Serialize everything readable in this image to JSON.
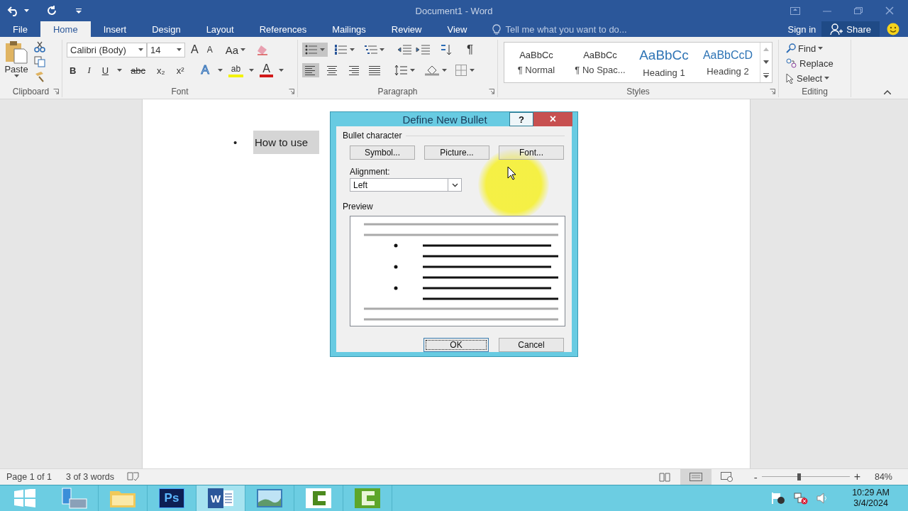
{
  "window": {
    "title": "Document1 - Word"
  },
  "tabs": [
    {
      "label": "File",
      "selected": false
    },
    {
      "label": "Home",
      "selected": true
    },
    {
      "label": "Insert",
      "selected": false
    },
    {
      "label": "Design",
      "selected": false
    },
    {
      "label": "Layout",
      "selected": false
    },
    {
      "label": "References",
      "selected": false
    },
    {
      "label": "Mailings",
      "selected": false
    },
    {
      "label": "Review",
      "selected": false
    },
    {
      "label": "View",
      "selected": false
    }
  ],
  "tell_me": {
    "placeholder": "Tell me what you want to do..."
  },
  "account": {
    "sign_in": "Sign in",
    "share": "Share"
  },
  "ribbon": {
    "clipboard": {
      "paste": "Paste",
      "label": "Clipboard"
    },
    "font": {
      "name": "Calibri (Body)",
      "size": "14",
      "grow": "A",
      "shrink": "A",
      "change_case": "Aa",
      "bold": "B",
      "italic": "I",
      "underline": "U",
      "strikethrough": "abc",
      "subscript": "x₂",
      "superscript": "x²",
      "text_effects": "A",
      "highlight": "ab",
      "font_color": "A",
      "label": "Font"
    },
    "paragraph": {
      "lists": [
        {
          "kind": "bullets",
          "selected": true
        },
        {
          "kind": "numbering",
          "selected": false
        },
        {
          "kind": "multilevel",
          "selected": false
        }
      ],
      "pilcrow": "¶",
      "alignment": [
        {
          "kind": "left",
          "selected": true
        },
        {
          "kind": "center",
          "selected": false
        },
        {
          "kind": "right",
          "selected": false
        },
        {
          "kind": "justify",
          "selected": false
        }
      ],
      "label": "Paragraph"
    },
    "styles": {
      "items": [
        {
          "kind": "normal",
          "sample": "AaBbCc",
          "name": "¶ Normal"
        },
        {
          "kind": "normal",
          "sample": "AaBbCc",
          "name": "¶ No Spac..."
        },
        {
          "kind": "heading1",
          "sample": "AaBbCc",
          "name": "Heading 1"
        },
        {
          "kind": "heading2",
          "sample": "AaBbCcD",
          "name": "Heading 2"
        }
      ],
      "label": "Styles"
    },
    "editing": {
      "find": "Find",
      "replace": "Replace",
      "select": "Select",
      "label": "Editing"
    }
  },
  "document": {
    "items": [
      {
        "bullet": "•",
        "text": "How to use",
        "selected": true
      }
    ]
  },
  "dialog": {
    "title": "Define New Bullet",
    "help": "?",
    "close": "×",
    "group": "Bullet character",
    "buttons": [
      "Symbol...",
      "Picture...",
      "Font..."
    ],
    "alignment_label": "Alignment:",
    "alignment_value": "Left",
    "preview_label": "Preview",
    "ok": "OK",
    "cancel": "Cancel"
  },
  "status_bar": {
    "page": "Page 1 of 1",
    "words": "3 of 3 words",
    "views": [
      {
        "kind": "read",
        "selected": false
      },
      {
        "kind": "print",
        "selected": true
      },
      {
        "kind": "web",
        "selected": false
      }
    ],
    "zoom_out": "-",
    "zoom_in": "+",
    "zoom": {
      "level": 0.42
    },
    "zoom_text": "84%"
  },
  "taskbar": {
    "apps": [
      {
        "kind": "server",
        "selected": false
      },
      {
        "kind": "folder",
        "selected": false
      },
      {
        "kind": "ps",
        "label": "Ps",
        "selected": false
      },
      {
        "kind": "word",
        "label": "W",
        "selected": true
      },
      {
        "kind": "photo",
        "selected": false
      },
      {
        "kind": "bracket-light",
        "selected": false
      },
      {
        "kind": "bracket-dark",
        "selected": false
      }
    ],
    "time": "10:29 AM",
    "date": "3/4/2024"
  }
}
